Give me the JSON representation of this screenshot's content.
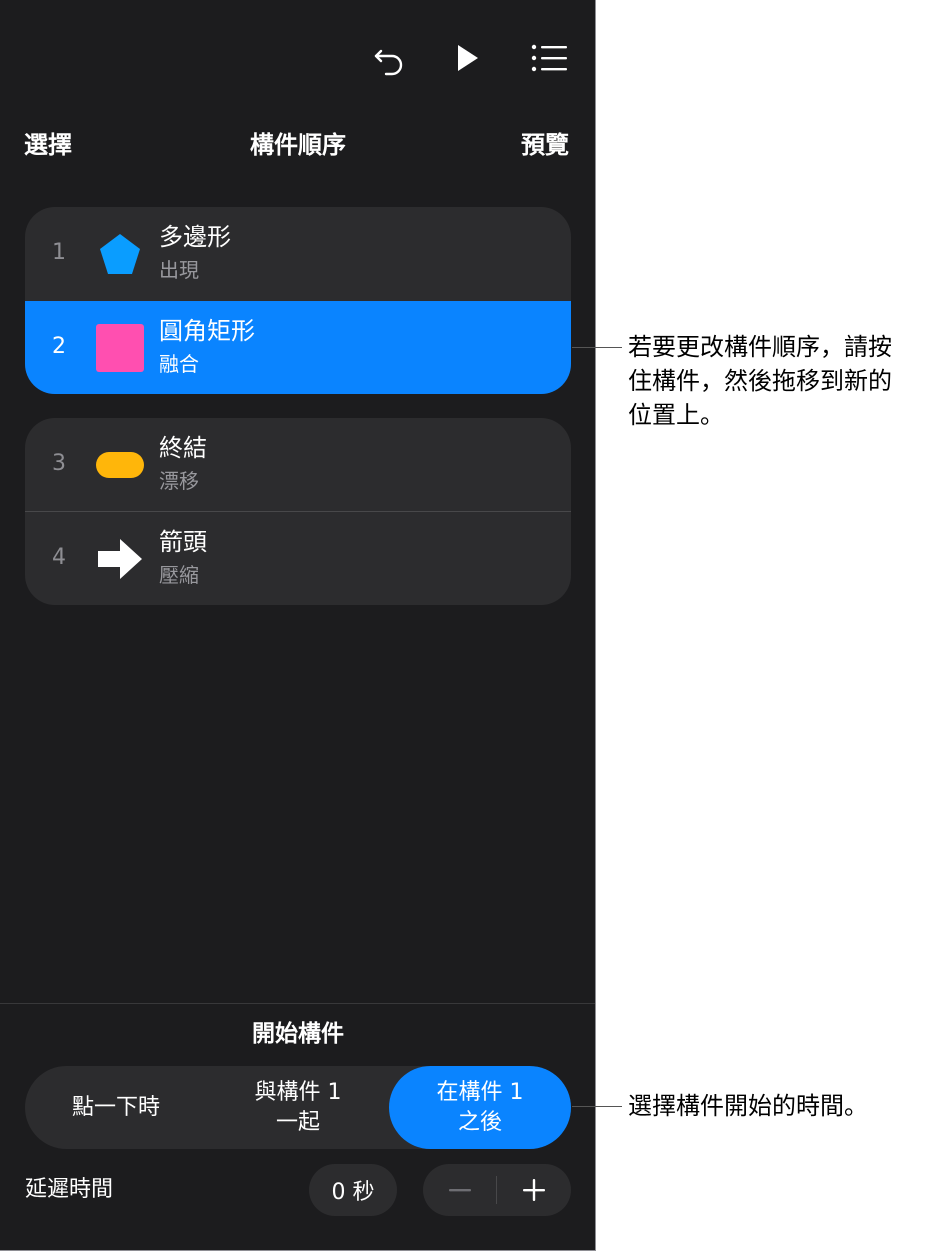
{
  "toolbar": {
    "undo_icon": "undo-arrow-icon",
    "play_icon": "play-icon",
    "list_icon": "list-icon"
  },
  "nav": {
    "select": "選擇",
    "title": "構件順序",
    "preview": "預覽"
  },
  "builds": [
    {
      "number": "1",
      "title": "多邊形",
      "effect": "出現",
      "shape": "pentagon",
      "color": "#0a9dff",
      "selected": false
    },
    {
      "number": "2",
      "title": "圓角矩形",
      "effect": "融合",
      "shape": "rounded-square",
      "color": "#ff4fb0",
      "selected": true
    },
    {
      "number": "3",
      "title": "終結",
      "effect": "漂移",
      "shape": "pill",
      "color": "#ffb60a",
      "selected": false
    },
    {
      "number": "4",
      "title": "箭頭",
      "effect": "壓縮",
      "shape": "arrow",
      "color": "#ffffff",
      "selected": false
    }
  ],
  "start_build": {
    "title": "開始構件",
    "options": [
      "點一下時",
      "與構件 1\n一起",
      "在構件 1\n之後"
    ],
    "selected_index": 2
  },
  "delay": {
    "label": "延遲時間",
    "value": "0 秒",
    "minus": "−",
    "plus": "+"
  },
  "callouts": {
    "reorder": "若要更改構件順序，請按\n住構件，然後拖移到新的\n位置上。",
    "start": "選擇構件開始的時間。"
  },
  "colors": {
    "accent": "#0a84ff",
    "panel_bg": "#1c1c1e",
    "group_bg": "#2c2c2e"
  }
}
